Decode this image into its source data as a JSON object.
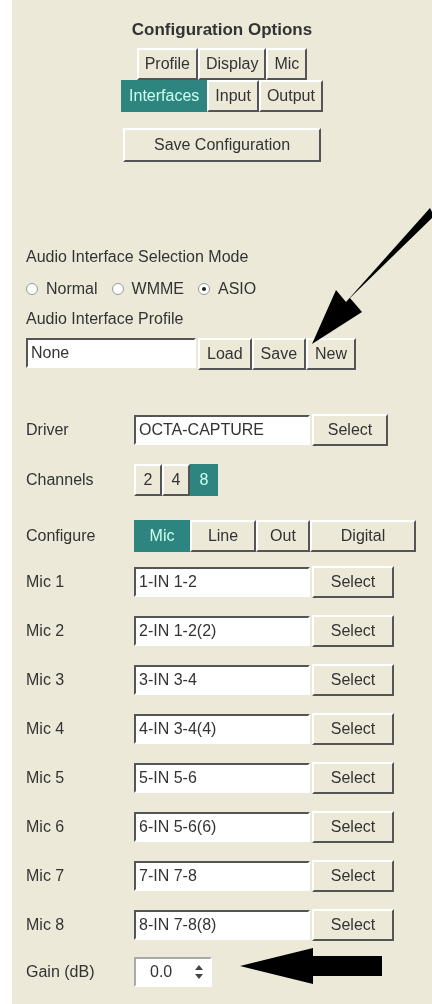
{
  "title": "Configuration Options",
  "tab_rows": [
    [
      {
        "label": "Profile",
        "selected": false
      },
      {
        "label": "Display",
        "selected": false
      },
      {
        "label": "Mic",
        "selected": false
      }
    ],
    [
      {
        "label": "Interfaces",
        "selected": true
      },
      {
        "label": "Input",
        "selected": false
      },
      {
        "label": "Output",
        "selected": false
      }
    ]
  ],
  "save_button": "Save Configuration",
  "selection_mode": {
    "label": "Audio Interface Selection Mode",
    "options": [
      {
        "label": "Normal",
        "selected": false
      },
      {
        "label": "WMME",
        "selected": false
      },
      {
        "label": "ASIO",
        "selected": true
      }
    ]
  },
  "profile": {
    "label": "Audio Interface Profile",
    "value": "None",
    "buttons": [
      "Load",
      "Save",
      "New"
    ]
  },
  "driver": {
    "label": "Driver",
    "value": "OCTA-CAPTURE",
    "button": "Select"
  },
  "channels": {
    "label": "Channels",
    "options": [
      {
        "label": "2",
        "selected": false
      },
      {
        "label": "4",
        "selected": false
      },
      {
        "label": "8",
        "selected": true
      }
    ]
  },
  "configure": {
    "label": "Configure",
    "options": [
      {
        "label": "Mic",
        "selected": true
      },
      {
        "label": "Line",
        "selected": false
      },
      {
        "label": "Out",
        "selected": false
      },
      {
        "label": "Digital",
        "selected": false
      }
    ]
  },
  "mics": [
    {
      "label": "Mic 1",
      "value": "1-IN 1-2",
      "button": "Select"
    },
    {
      "label": "Mic 2",
      "value": "2-IN 1-2(2)",
      "button": "Select"
    },
    {
      "label": "Mic 3",
      "value": "3-IN 3-4",
      "button": "Select"
    },
    {
      "label": "Mic 4",
      "value": "4-IN 3-4(4)",
      "button": "Select"
    },
    {
      "label": "Mic 5",
      "value": "5-IN 5-6",
      "button": "Select"
    },
    {
      "label": "Mic 6",
      "value": "6-IN 5-6(6)",
      "button": "Select"
    },
    {
      "label": "Mic 7",
      "value": "7-IN 7-8",
      "button": "Select"
    },
    {
      "label": "Mic 8",
      "value": "8-IN 7-8(8)",
      "button": "Select"
    }
  ],
  "gain": {
    "label": "Gain (dB)",
    "value": "0.0"
  }
}
